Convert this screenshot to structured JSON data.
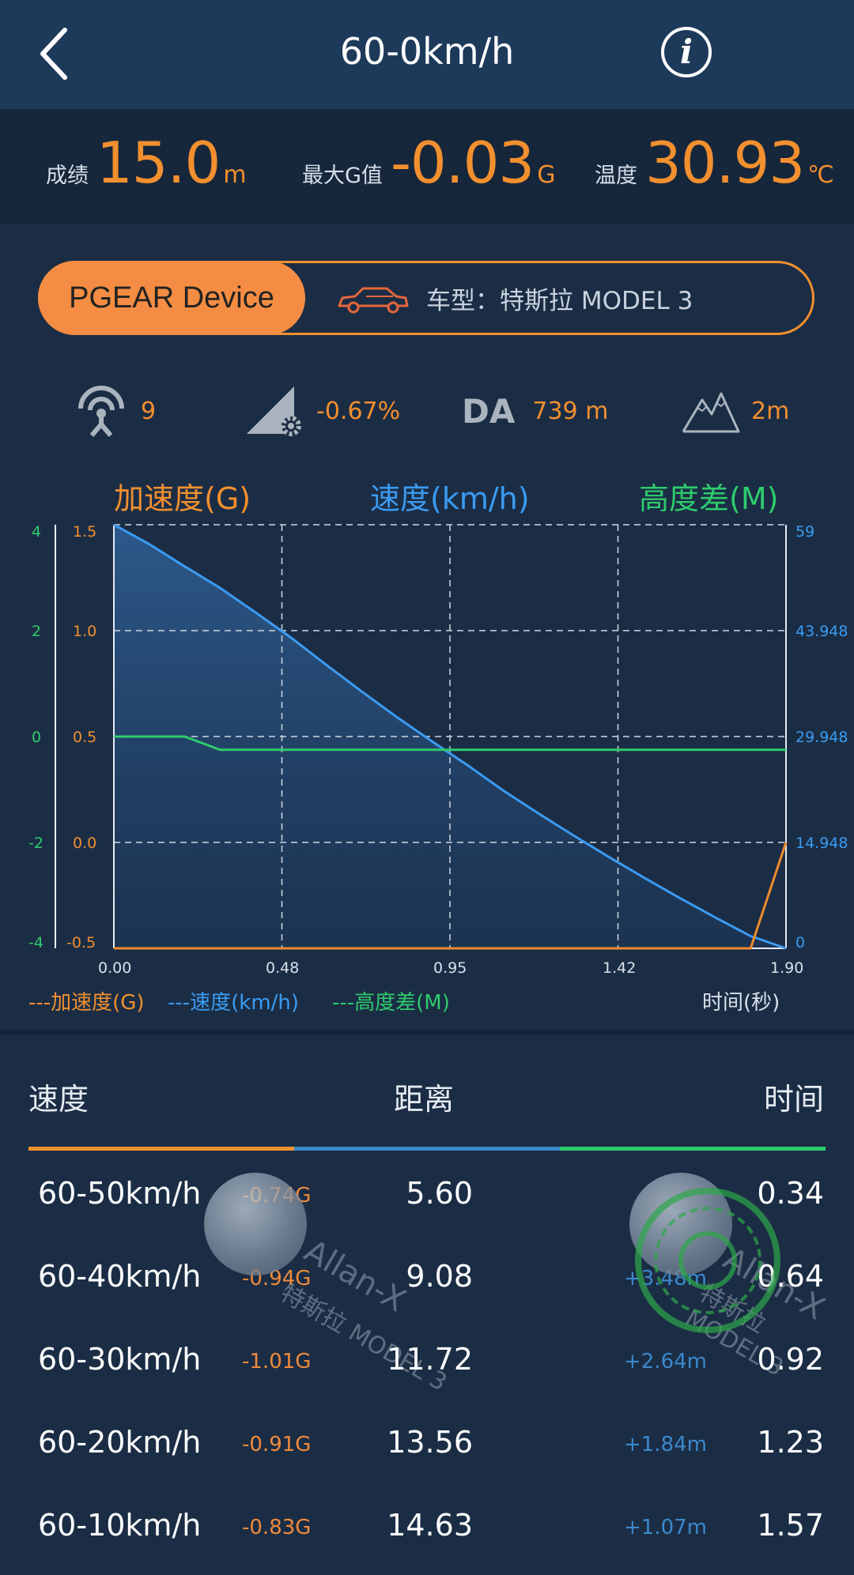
{
  "header": {
    "title": "60-0km/h"
  },
  "stats": {
    "score_label": "成绩",
    "score_value": "15.0",
    "score_unit": "m",
    "maxg_label": "最大G值",
    "maxg_value": "-0.03",
    "maxg_unit": "G",
    "temp_label": "温度",
    "temp_value": "30.93",
    "temp_unit": "℃"
  },
  "device": {
    "name": "PGEAR Device",
    "car": "车型：特斯拉 MODEL 3"
  },
  "sensors": {
    "satellites": "9",
    "slope": "-0.67%",
    "da_label": "DA",
    "da_value": "739 m",
    "altitude": "2m"
  },
  "chart_legend_top": {
    "g": "加速度(G)",
    "speed": "速度(km/h)",
    "alt": "高度差(M)"
  },
  "chart_legend_bottom": {
    "g": "---加速度(G)",
    "speed": "---速度(km/h)",
    "alt": "---高度差(M)",
    "time": "时间(秒)"
  },
  "chart_data": {
    "type": "line",
    "x": [
      0.0,
      0.1,
      0.2,
      0.3,
      0.4,
      0.5,
      0.6,
      0.7,
      0.8,
      0.9,
      1.0,
      1.1,
      1.2,
      1.3,
      1.4,
      1.5,
      1.6,
      1.7,
      1.8,
      1.9
    ],
    "xticks": [
      "0.00",
      "0.48",
      "0.95",
      "1.42",
      "1.90"
    ],
    "xlim": [
      0,
      1.9
    ],
    "xlabel": "时间(秒)",
    "series": [
      {
        "name": "速度(km/h)",
        "axis": "right",
        "color": "#3b9bf2",
        "values": [
          59,
          56.3,
          53.2,
          50.2,
          46.8,
          43.3,
          39.5,
          35.8,
          32.2,
          28.8,
          25.5,
          22.0,
          18.8,
          15.7,
          12.7,
          9.8,
          7.0,
          4.3,
          1.7,
          0
        ]
      },
      {
        "name": "高度差(M)",
        "axis": "left-outer",
        "color": "#2ecb6c",
        "values": [
          0,
          0,
          0,
          -0.25,
          -0.25,
          -0.25,
          -0.25,
          -0.25,
          -0.25,
          -0.25,
          -0.25,
          -0.25,
          -0.25,
          -0.25,
          -0.25,
          -0.25,
          -0.25,
          -0.25,
          -0.25,
          -0.25
        ]
      },
      {
        "name": "加速度(G)",
        "axis": "left",
        "color": "#f08a2e",
        "values": [
          -0.5,
          -0.5,
          -0.5,
          -0.5,
          -0.5,
          -0.5,
          -0.5,
          -0.5,
          -0.5,
          -0.5,
          -0.5,
          -0.5,
          -0.5,
          -0.5,
          -0.5,
          -0.5,
          -0.5,
          -0.5,
          -0.5,
          0.0
        ]
      }
    ],
    "y_left": {
      "label": "加速度(G)",
      "ticks": [
        "1.5",
        "1.0",
        "0.5",
        "0.0",
        "-0.5"
      ],
      "ylim": [
        -0.5,
        1.5
      ]
    },
    "y_left_outer": {
      "label": "高度差(M)",
      "ticks": [
        "4",
        "2",
        "0",
        "-2",
        "-4"
      ],
      "ylim": [
        -4,
        4
      ]
    },
    "y_right": {
      "label": "速度(km/h)",
      "ticks": [
        "59",
        "43.948",
        "29.948",
        "14.948",
        "0"
      ],
      "ylim": [
        0,
        59
      ]
    },
    "grid": true
  },
  "table": {
    "headers": {
      "speed": "速度",
      "distance": "距离",
      "time": "时间"
    },
    "rows": [
      {
        "range": "60-50km/h",
        "g": "-0.74G",
        "distance": "5.60",
        "delta": "",
        "time": "0.34"
      },
      {
        "range": "60-40km/h",
        "g": "-0.94G",
        "distance": "9.08",
        "delta": "+3.48m",
        "time": "0.64"
      },
      {
        "range": "60-30km/h",
        "g": "-1.01G",
        "distance": "11.72",
        "delta": "+2.64m",
        "time": "0.92"
      },
      {
        "range": "60-20km/h",
        "g": "-0.91G",
        "distance": "13.56",
        "delta": "+1.84m",
        "time": "1.23"
      },
      {
        "range": "60-10km/h",
        "g": "-0.83G",
        "distance": "14.63",
        "delta": "+1.07m",
        "time": "1.57"
      }
    ]
  },
  "watermark": {
    "user": "Allan-X",
    "car": "特斯拉 MODEL 3"
  },
  "colors": {
    "accent": "#f28f2e",
    "speed": "#3b9bf2",
    "altitude": "#2ecb6c",
    "background": "#1b2d45"
  }
}
